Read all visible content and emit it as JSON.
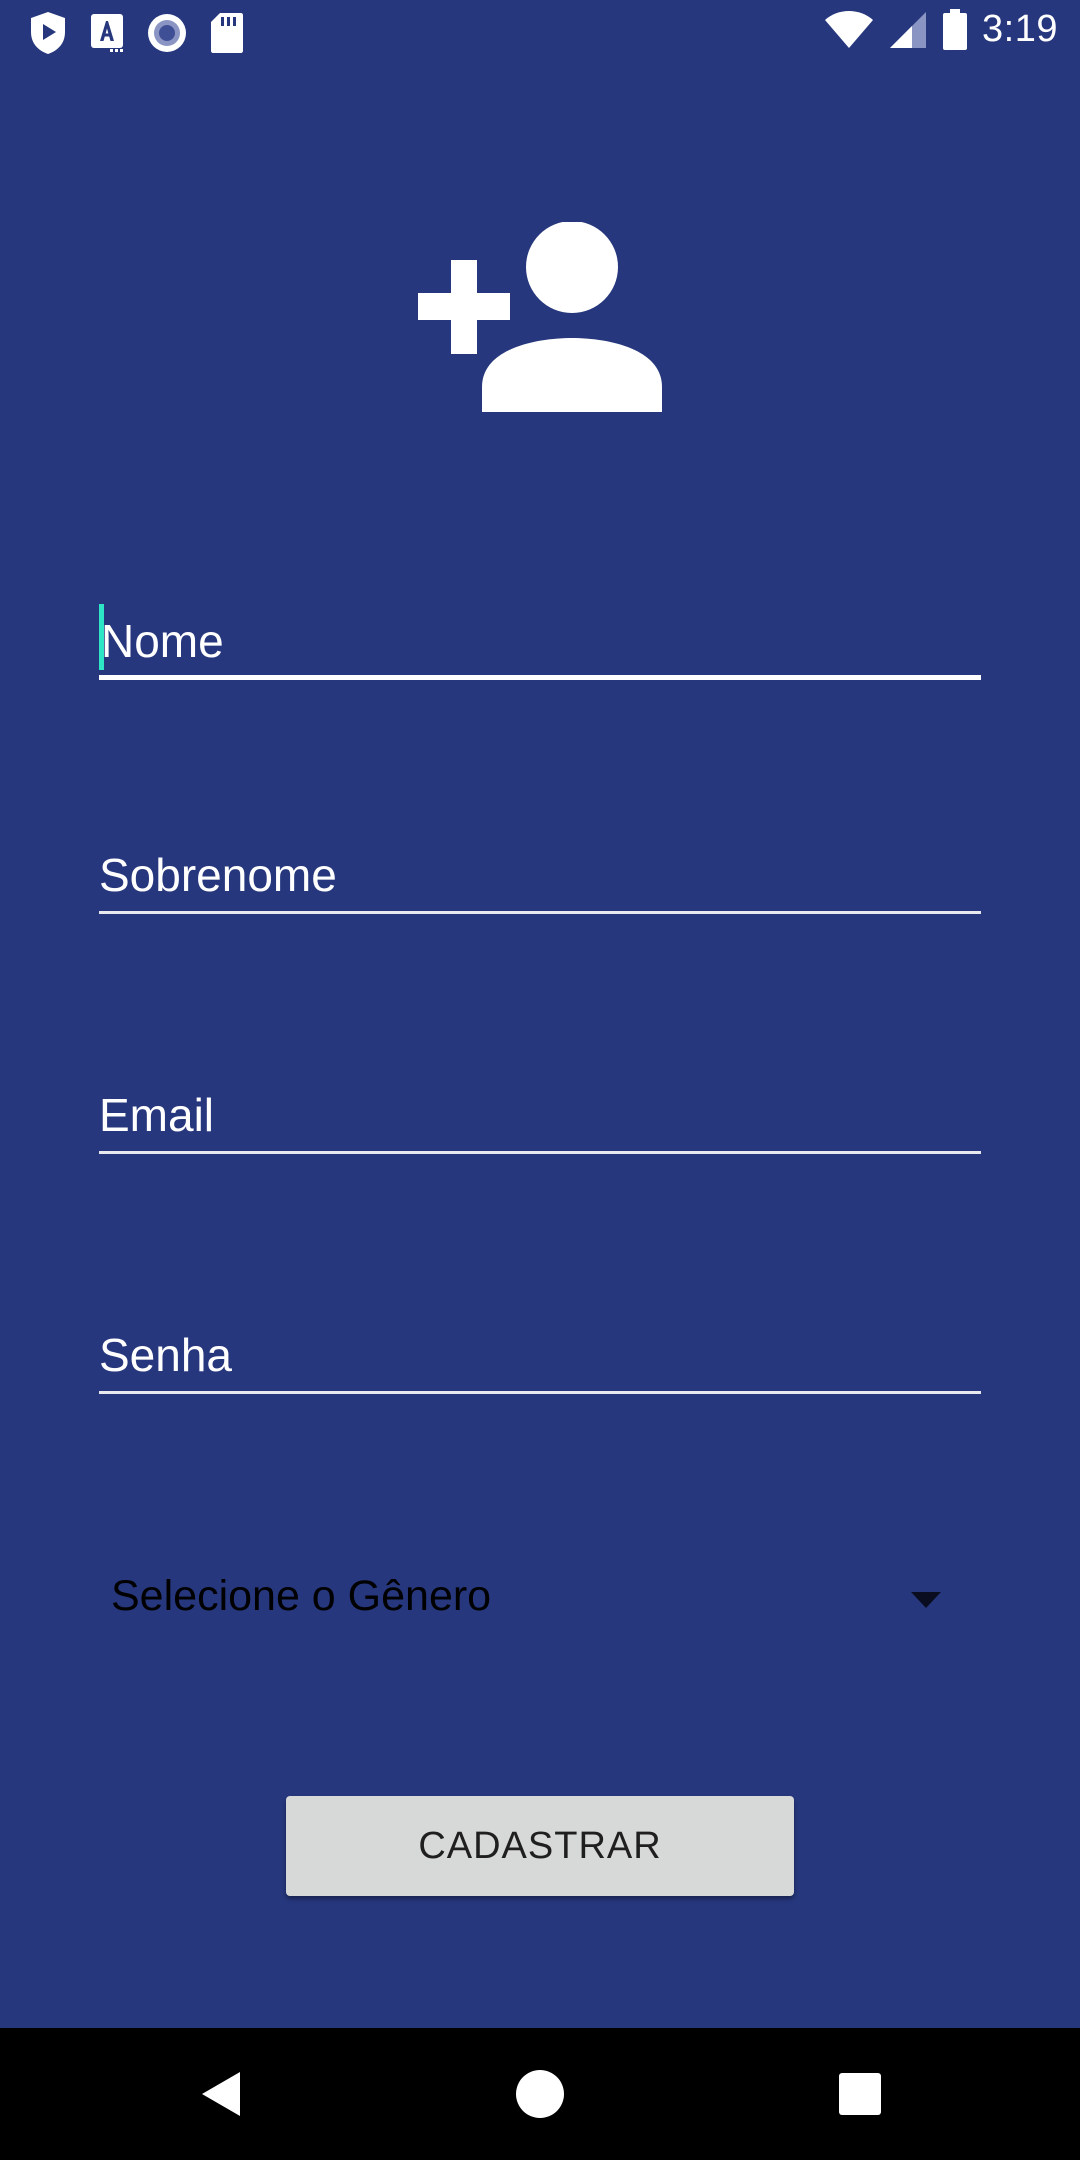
{
  "status_bar": {
    "time": "3:19",
    "left_icons": [
      "play-protect-icon",
      "translate-icon",
      "record-icon",
      "sd-card-icon"
    ],
    "right_icons": [
      "wifi-icon",
      "signal-icon",
      "battery-icon"
    ]
  },
  "header": {
    "icon": "add-person-icon"
  },
  "form": {
    "name_placeholder": "Nome",
    "surname_placeholder": "Sobrenome",
    "email_placeholder": "Email",
    "password_placeholder": "Senha",
    "gender_selected": "Selecione o Gênero",
    "submit_label": "CADASTRAR"
  },
  "nav_bar": {
    "buttons": [
      "back-icon",
      "home-icon",
      "recents-icon"
    ]
  },
  "colors": {
    "background": "#26377d",
    "cursor": "#2ee6c6",
    "button": "#d7d8d8",
    "nav_bar": "#000000"
  }
}
